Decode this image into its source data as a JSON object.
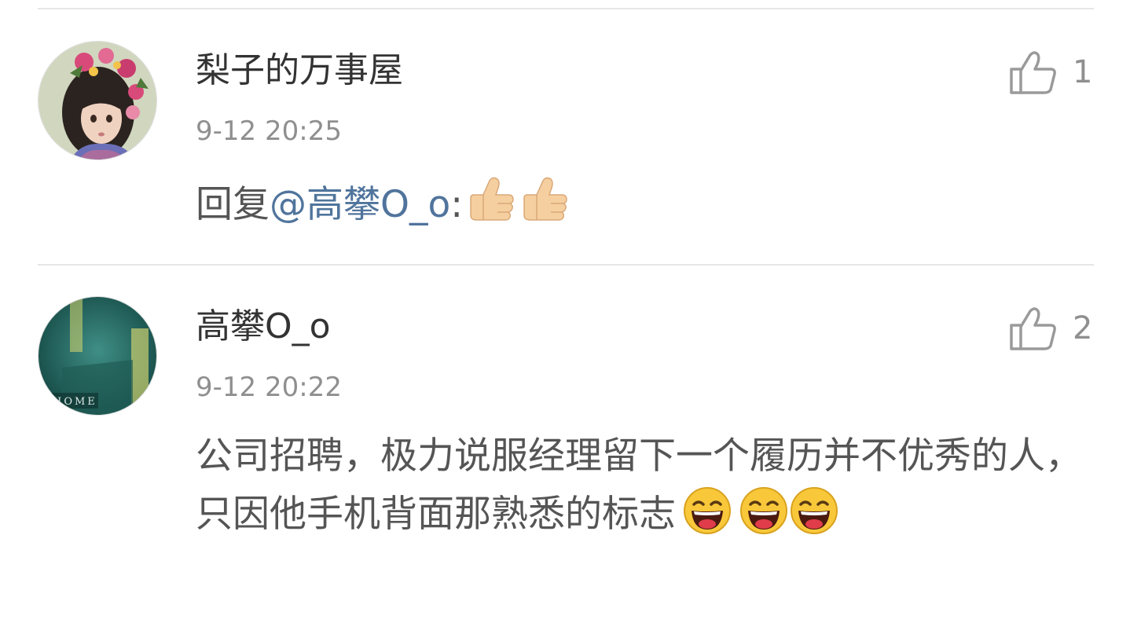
{
  "comments": [
    {
      "username": "梨子的万事屋",
      "timestamp": "9-12 20:25",
      "likes": "1",
      "reply_prefix": "回复",
      "mention": "@高攀O_o",
      "colon": ":",
      "emojis": [
        "thumbs-up-emoji",
        "thumbs-up-emoji"
      ]
    },
    {
      "username": "高攀O_o",
      "timestamp": "9-12 20:22",
      "likes": "2",
      "avatar_caption": "HOME",
      "text": "公司招聘，极力说服经理留下一个履历并不优秀的人，只因他手机背面那熟悉的标志",
      "emojis": [
        "laughing-emoji",
        "laughing-emoji",
        "laughing-emoji"
      ]
    }
  ],
  "colors": {
    "mention": "#50749c",
    "divider": "#e6e6e6",
    "meta_text": "#8f8f8f"
  }
}
